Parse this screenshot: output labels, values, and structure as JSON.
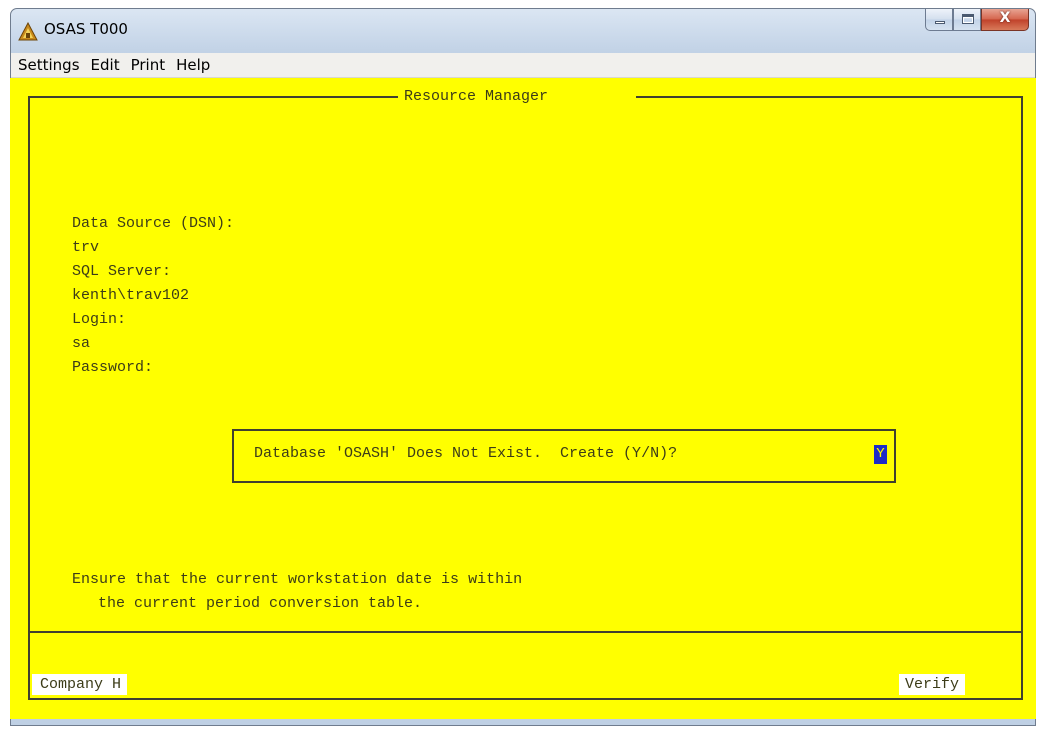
{
  "window": {
    "title": "OSAS T000",
    "icon": "osas-app-icon",
    "caption_buttons": [
      "minimize",
      "maximize",
      "close"
    ]
  },
  "menubar": {
    "items": [
      "Settings",
      "Edit",
      "Print",
      "Help"
    ]
  },
  "terminal": {
    "background_color": "#ffff00",
    "frame_title": "Resource Manager",
    "fields": {
      "dsn_label": "Data Source (DSN):",
      "dsn_value": "trv",
      "server_label": "SQL Server:",
      "server_value": "kenth\\trav102",
      "login_label": "Login:",
      "login_value": "sa",
      "password_label": "Password:"
    },
    "dialog": {
      "prompt": "Database 'OSASH' Does Not Exist.  Create (Y/N)?",
      "cursor_value": "Y",
      "cursor_color": "#1c2cc8"
    },
    "message_line1": "Ensure that the current workstation date is within",
    "message_line2": "the current period conversion table.",
    "footer": {
      "company": "Company H",
      "mode": "Verify"
    }
  }
}
